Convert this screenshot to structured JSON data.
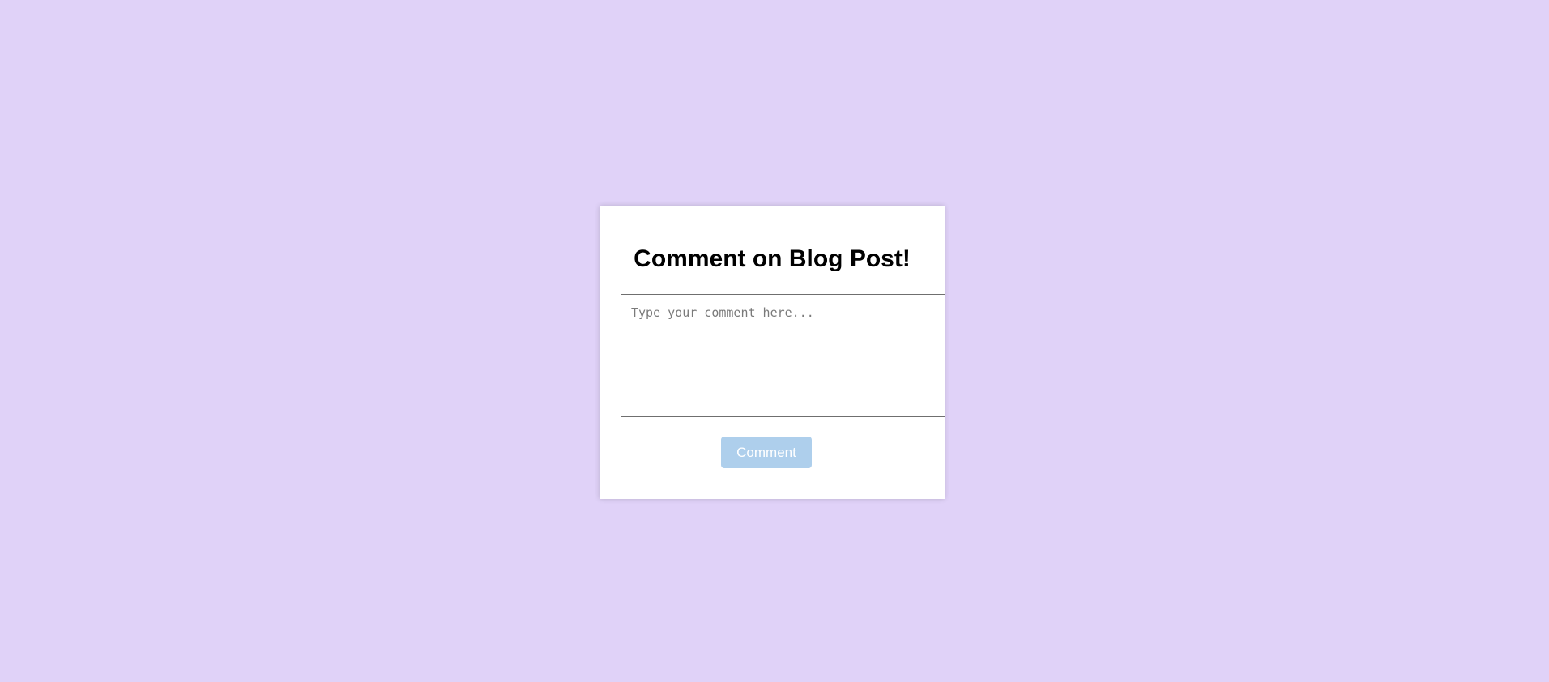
{
  "colors": {
    "page_background": "#e0d2f8",
    "card_background": "#ffffff",
    "button_background": "#aecfec",
    "button_text": "#ffffff"
  },
  "card": {
    "title": "Comment on Blog Post!",
    "comment_input": {
      "value": "",
      "placeholder": "Type your comment here..."
    },
    "submit_button": {
      "label": "Comment",
      "state": "disabled"
    }
  }
}
